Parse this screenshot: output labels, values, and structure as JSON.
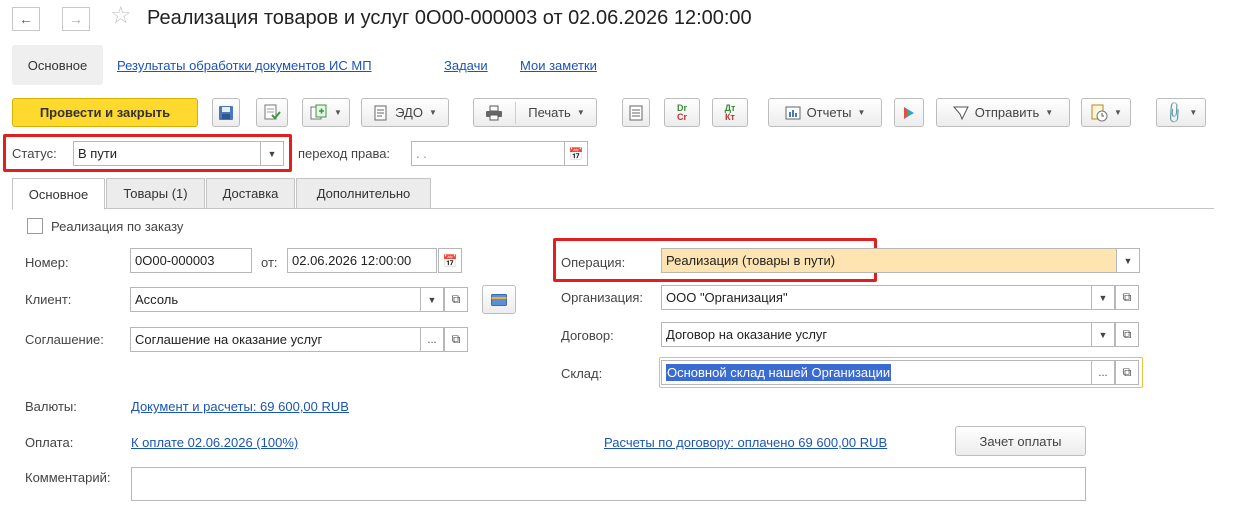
{
  "window": {
    "title": "Реализация товаров и услуг 0О00-000003 от 02.06.2026 12:00:00"
  },
  "sections": {
    "active": "Основное",
    "links": [
      "Результаты обработки документов ИС МП",
      "Задачи",
      "Мои заметки"
    ]
  },
  "toolbar": {
    "post_close": "Провести и закрыть",
    "edo": "ЭДО",
    "print": "Печать",
    "dt_kt": "Дт Кт",
    "reports": "Отчеты",
    "send": "Отправить"
  },
  "status": {
    "label": "Статус:",
    "value": "В пути",
    "transfer_label": "переход права:",
    "transfer_value": " .  ."
  },
  "tabs": [
    {
      "label": "Основное",
      "active": true
    },
    {
      "label": "Товары (1)",
      "active": false
    },
    {
      "label": "Доставка",
      "active": false
    },
    {
      "label": "Дополнительно",
      "active": false
    }
  ],
  "form": {
    "by_order_label": "Реализация по заказу",
    "by_order_checked": false,
    "number_label": "Номер:",
    "number_value": "0О00-000003",
    "date_label": "от:",
    "date_value": "02.06.2026 12:00:00",
    "client_label": "Клиент:",
    "client_value": "Ассоль",
    "agreement_label": "Соглашение:",
    "agreement_value": "Соглашение на оказание услуг",
    "operation_label": "Операция:",
    "operation_value": "Реализация (товары в пути)",
    "org_label": "Организация:",
    "org_value": "ООО \"Организация\"",
    "contract_label": "Договор:",
    "contract_value": "Договор на оказание услуг",
    "warehouse_label": "Склад:",
    "warehouse_value": "Основной склад нашей Организации",
    "currency_label": "Валюты:",
    "currency_link": "Документ и расчеты: 69 600,00 RUB",
    "payment_label": "Оплата:",
    "payment_link": "К оплате 02.06.2026 (100%)",
    "settlement_link": "Расчеты по договору: оплачено 69 600,00 RUB",
    "offset_button": "Зачет оплаты",
    "comment_label": "Комментарий:",
    "comment_value": ""
  },
  "colors": {
    "primary_button": "#ffd92e",
    "highlight_field": "#fde4b0",
    "selection": "#3a6bd0",
    "annotation_red": "#e02020",
    "link": "#1b55b3"
  }
}
